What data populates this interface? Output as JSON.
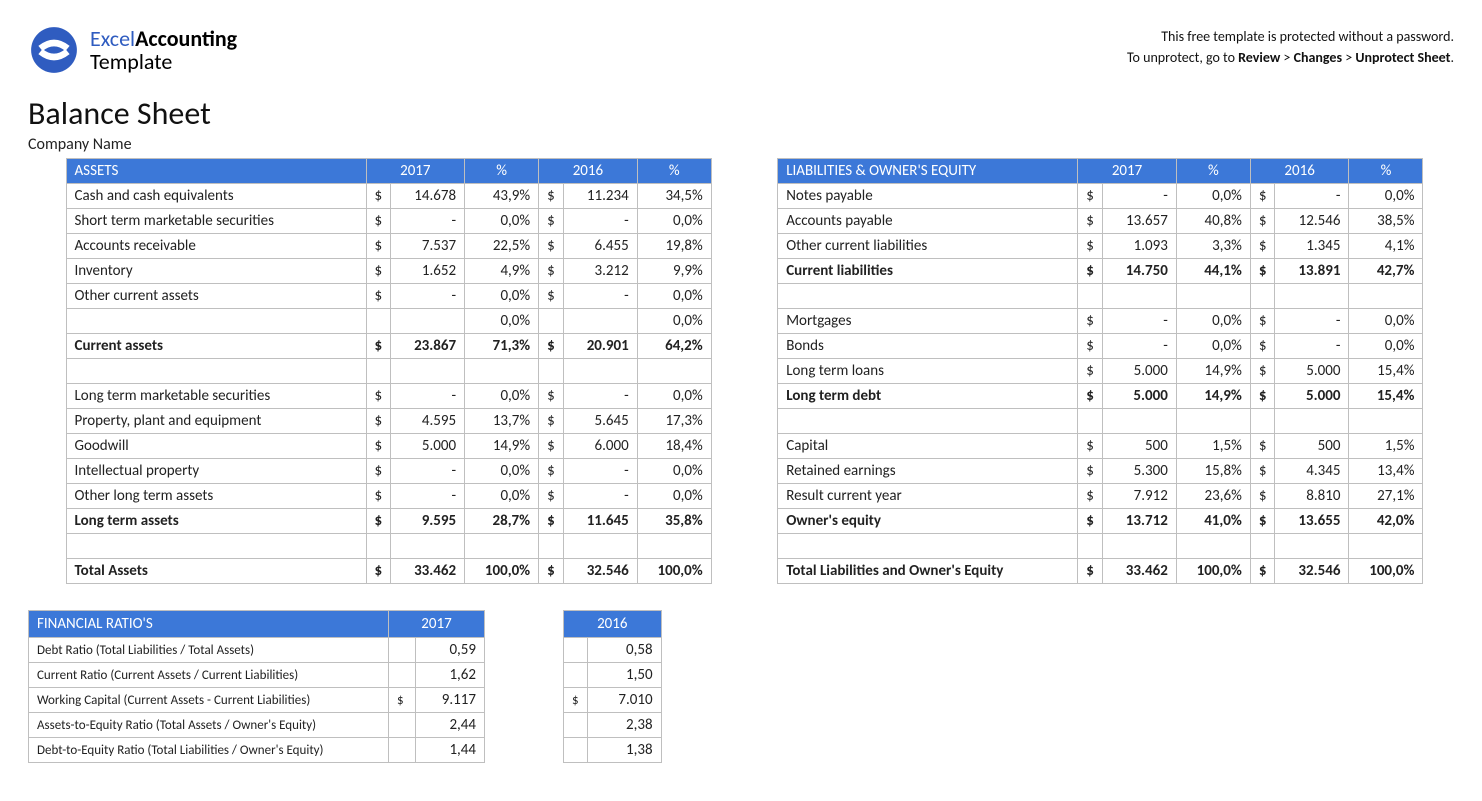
{
  "header": {
    "logo": {
      "line1a": "Excel",
      "line1b": "Accounting",
      "line2": "Template"
    },
    "notice_line1": "This free template is protected without a password.",
    "notice_line2_a": "To unprotect, go to ",
    "notice_line2_b": "Review",
    "notice_line2_c": " > ",
    "notice_line2_d": "Changes",
    "notice_line2_e": " > ",
    "notice_line2_f": "Unprotect Sheet",
    "notice_line2_g": "."
  },
  "title": "Balance Sheet",
  "company": "Company Name",
  "years": {
    "a": "2017",
    "b": "2016"
  },
  "pct_label": "%",
  "assets": {
    "header": "ASSETS",
    "rows": [
      {
        "label": "Cash and cash equivalents",
        "a": "14.678",
        "ap": "43,9%",
        "b": "11.234",
        "bp": "34,5%"
      },
      {
        "label": "Short term marketable securities",
        "a": "-",
        "ap": "0,0%",
        "b": "-",
        "bp": "0,0%"
      },
      {
        "label": "Accounts receivable",
        "a": "7.537",
        "ap": "22,5%",
        "b": "6.455",
        "bp": "19,8%"
      },
      {
        "label": "Inventory",
        "a": "1.652",
        "ap": "4,9%",
        "b": "3.212",
        "bp": "9,9%"
      },
      {
        "label": "Other current assets",
        "a": "-",
        "ap": "0,0%",
        "b": "-",
        "bp": "0,0%"
      },
      {
        "label": "",
        "a": "",
        "ap": "0,0%",
        "b": "",
        "bp": "0,0%",
        "nocur": true
      },
      {
        "label": "Current assets",
        "a": "23.867",
        "ap": "71,3%",
        "b": "20.901",
        "bp": "64,2%",
        "bold": true
      },
      {
        "spacer": true
      },
      {
        "label": "Long term marketable securities",
        "a": "-",
        "ap": "0,0%",
        "b": "-",
        "bp": "0,0%"
      },
      {
        "label": "Property, plant and equipment",
        "a": "4.595",
        "ap": "13,7%",
        "b": "5.645",
        "bp": "17,3%"
      },
      {
        "label": "Goodwill",
        "a": "5.000",
        "ap": "14,9%",
        "b": "6.000",
        "bp": "18,4%"
      },
      {
        "label": "Intellectual property",
        "a": "-",
        "ap": "0,0%",
        "b": "-",
        "bp": "0,0%"
      },
      {
        "label": "Other long term assets",
        "a": "-",
        "ap": "0,0%",
        "b": "-",
        "bp": "0,0%"
      },
      {
        "label": "Long term assets",
        "a": "9.595",
        "ap": "28,7%",
        "b": "11.645",
        "bp": "35,8%",
        "bold": true
      },
      {
        "spacer": true
      },
      {
        "label": "Total Assets",
        "a": "33.462",
        "ap": "100,0%",
        "b": "32.546",
        "bp": "100,0%",
        "bold": true
      }
    ]
  },
  "liab": {
    "header": "LIABILITIES & OWNER'S EQUITY",
    "rows": [
      {
        "label": "Notes payable",
        "a": "-",
        "ap": "0,0%",
        "b": "-",
        "bp": "0,0%"
      },
      {
        "label": "Accounts payable",
        "a": "13.657",
        "ap": "40,8%",
        "b": "12.546",
        "bp": "38,5%"
      },
      {
        "label": "Other current liabilities",
        "a": "1.093",
        "ap": "3,3%",
        "b": "1.345",
        "bp": "4,1%"
      },
      {
        "label": "Current liabilities",
        "a": "14.750",
        "ap": "44,1%",
        "b": "13.891",
        "bp": "42,7%",
        "bold": true
      },
      {
        "spacer": true
      },
      {
        "label": "Mortgages",
        "a": "-",
        "ap": "0,0%",
        "b": "-",
        "bp": "0,0%"
      },
      {
        "label": "Bonds",
        "a": "-",
        "ap": "0,0%",
        "b": "-",
        "bp": "0,0%"
      },
      {
        "label": "Long term loans",
        "a": "5.000",
        "ap": "14,9%",
        "b": "5.000",
        "bp": "15,4%"
      },
      {
        "label": "Long term debt",
        "a": "5.000",
        "ap": "14,9%",
        "b": "5.000",
        "bp": "15,4%",
        "bold": true
      },
      {
        "spacer": true
      },
      {
        "label": "Capital",
        "a": "500",
        "ap": "1,5%",
        "b": "500",
        "bp": "1,5%"
      },
      {
        "label": "Retained earnings",
        "a": "5.300",
        "ap": "15,8%",
        "b": "4.345",
        "bp": "13,4%"
      },
      {
        "label": "Result current year",
        "a": "7.912",
        "ap": "23,6%",
        "b": "8.810",
        "bp": "27,1%"
      },
      {
        "label": "Owner's equity",
        "a": "13.712",
        "ap": "41,0%",
        "b": "13.655",
        "bp": "42,0%",
        "bold": true
      },
      {
        "spacer": true
      },
      {
        "label": "Total Liabilities and Owner's Equity",
        "a": "33.462",
        "ap": "100,0%",
        "b": "32.546",
        "bp": "100,0%",
        "bold": true
      }
    ]
  },
  "ratios": {
    "header": "FINANCIAL RATIO'S",
    "rows": [
      {
        "label": "Debt Ratio (Total Liabilities / Total Assets)",
        "a": "0,59",
        "b": "0,58"
      },
      {
        "label": "Current Ratio (Current Assets / Current Liabilities)",
        "a": "1,62",
        "b": "1,50"
      },
      {
        "label": "Working Capital (Current Assets - Current Liabilities)",
        "a": "9.117",
        "b": "7.010",
        "cur": true
      },
      {
        "label": "Assets-to-Equity Ratio (Total Assets / Owner's Equity)",
        "a": "2,44",
        "b": "2,38"
      },
      {
        "label": "Debt-to-Equity Ratio (Total Liabilities / Owner's Equity)",
        "a": "1,44",
        "b": "1,38"
      }
    ]
  },
  "currency": "$"
}
